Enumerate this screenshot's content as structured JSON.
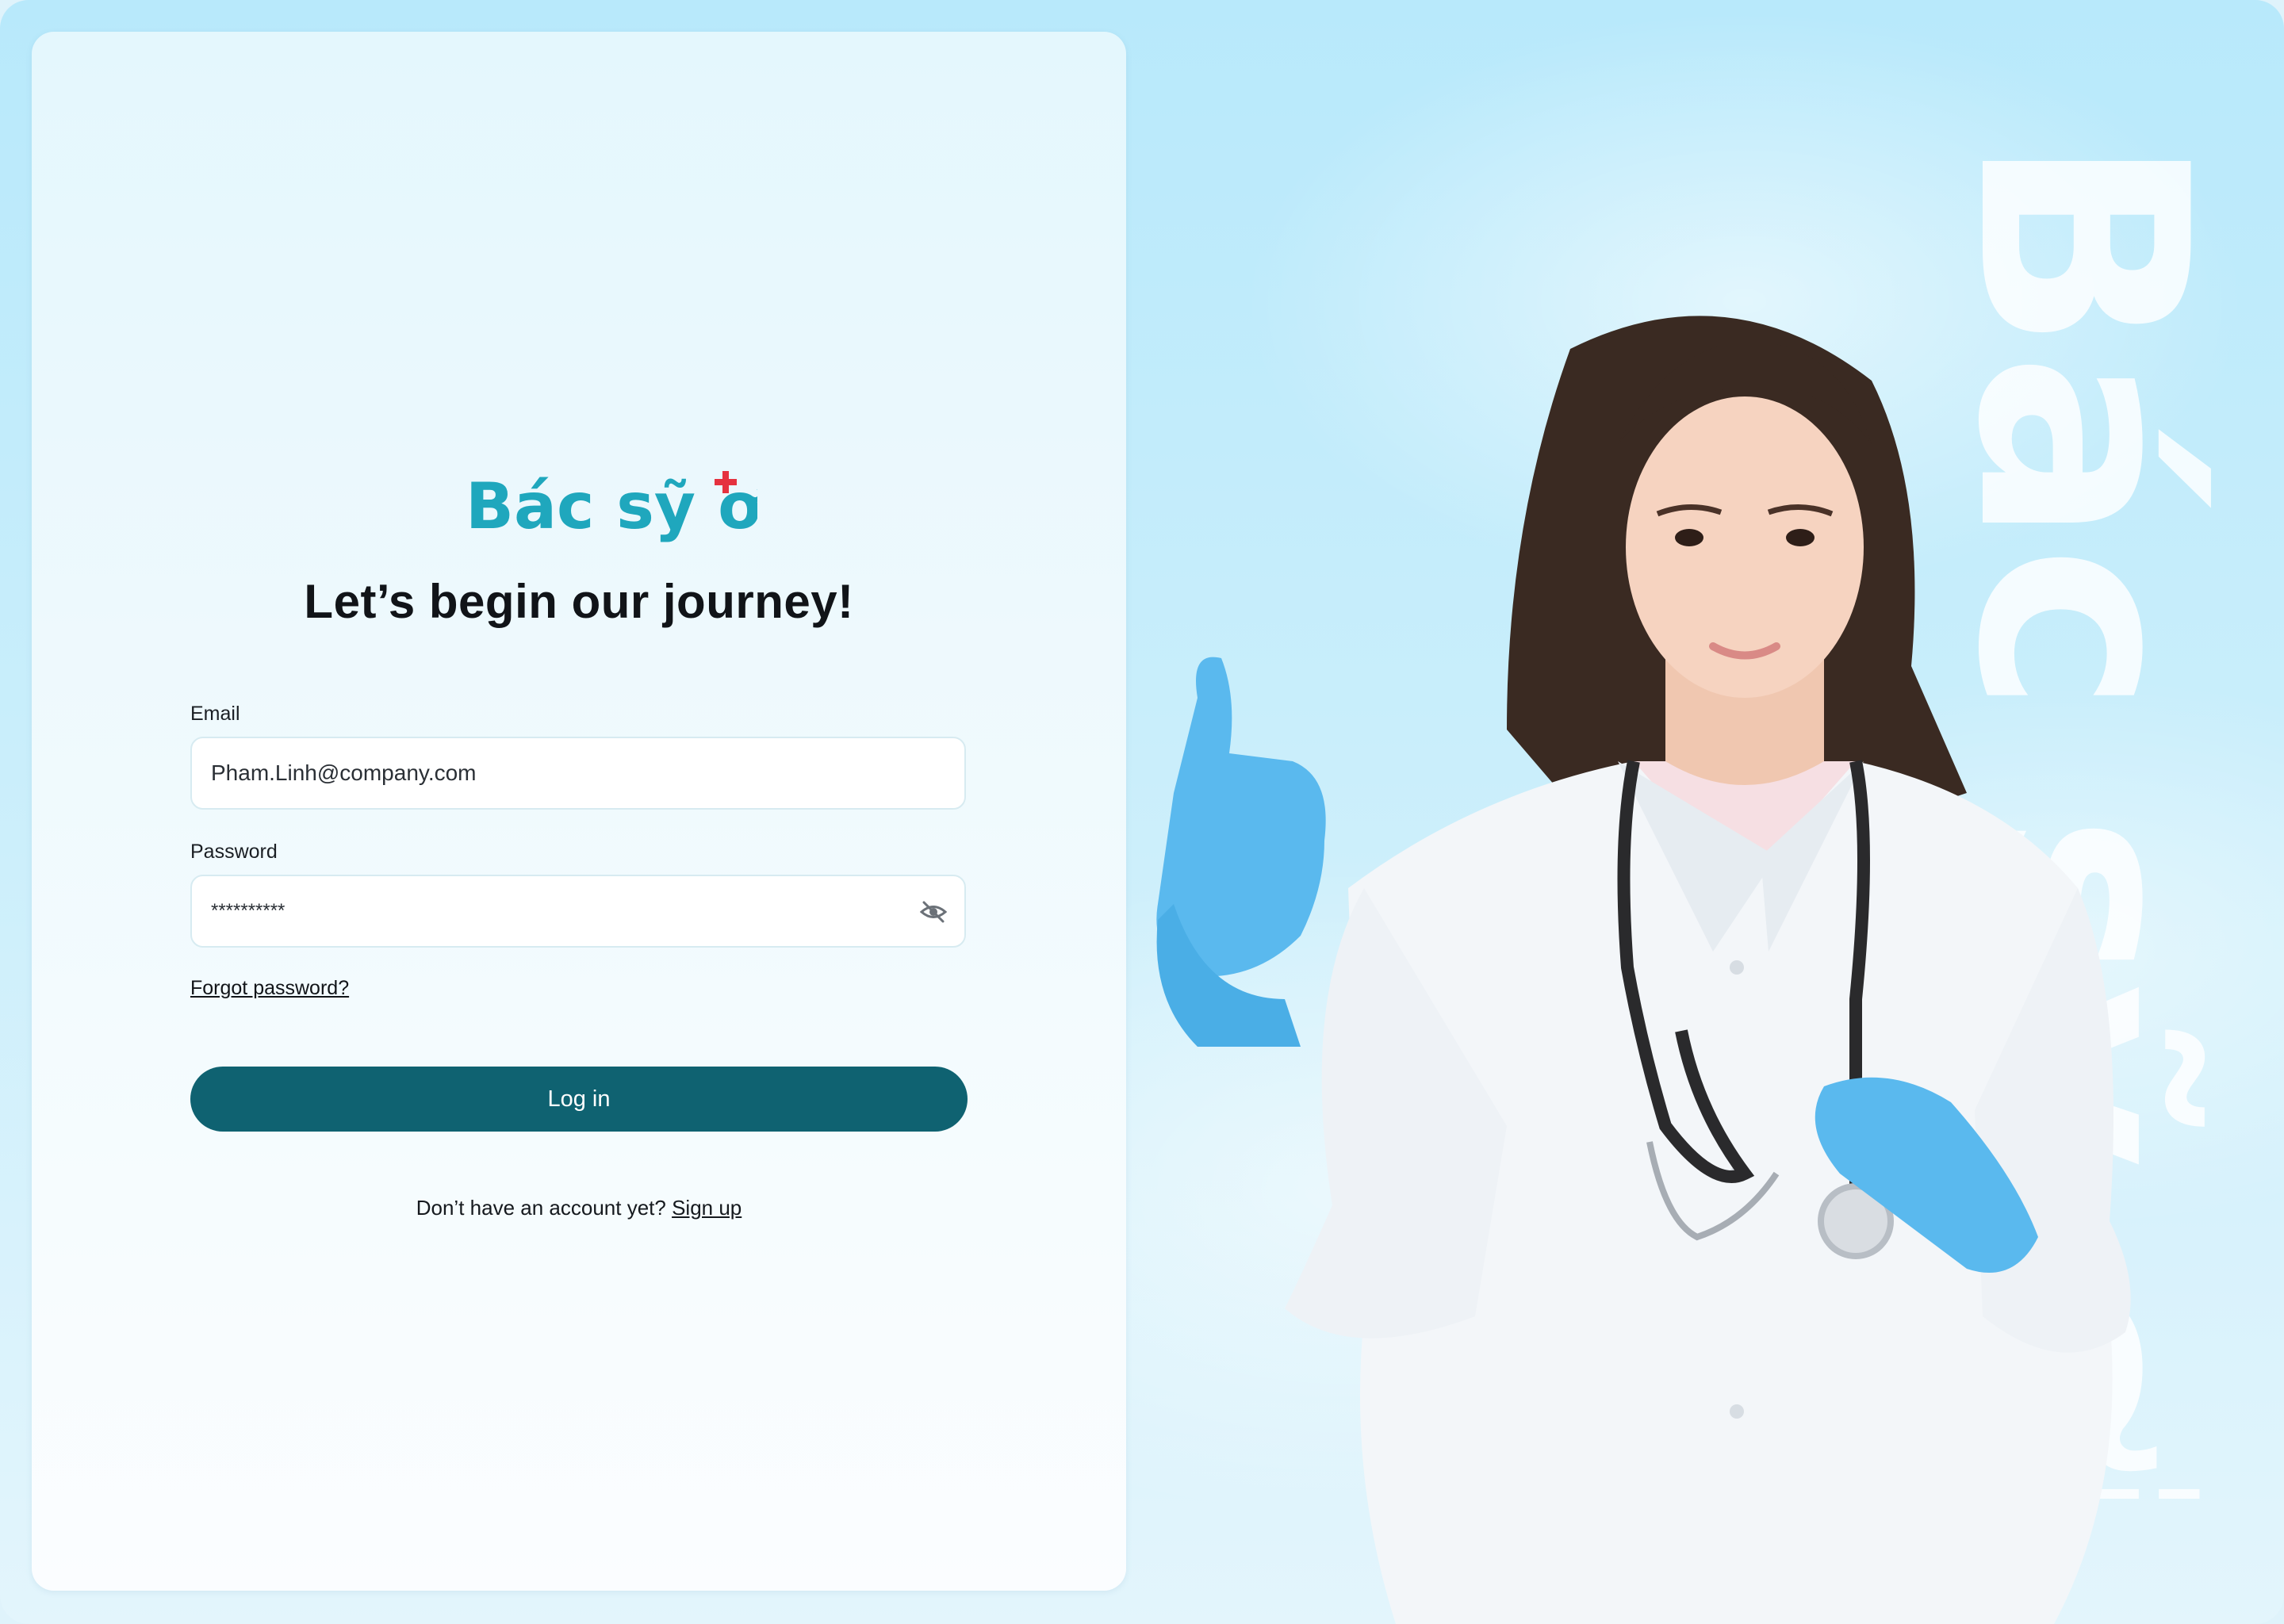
{
  "brand": {
    "logo_text": "Bác sỹ ơi",
    "watermark_text": "Bác sỹ ơi"
  },
  "heading": "Let’s begin our journey!",
  "form": {
    "email_label": "Email",
    "email_value": "Pham.Linh@company.com",
    "password_label": "Password",
    "password_value": "**********",
    "forgot_label": "Forgot password?",
    "login_label": "Log in"
  },
  "signup": {
    "prompt": "Don’t have an account yet?",
    "link_label": "Sign up"
  },
  "colors": {
    "primary": "#0f6271",
    "logo_teal": "#1fa7bd",
    "logo_cross": "#e5323f",
    "background_sky": "#b8e9fb"
  },
  "icons": {
    "password_toggle": "eye-off-icon"
  }
}
